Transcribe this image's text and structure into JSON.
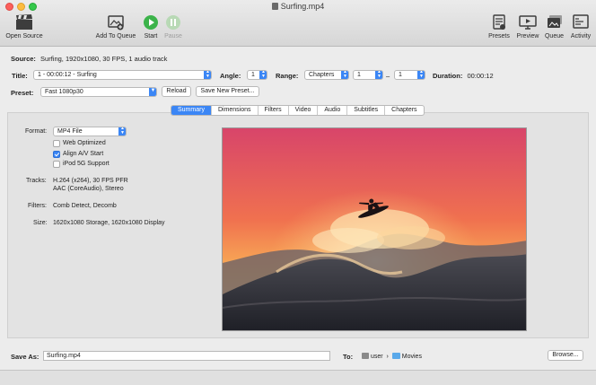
{
  "window": {
    "title": "Surfing.mp4"
  },
  "toolbar": {
    "open_source": "Open Source",
    "add_to_queue": "Add To Queue",
    "start": "Start",
    "pause": "Pause",
    "presets": "Presets",
    "preview": "Preview",
    "queue": "Queue",
    "activity": "Activity"
  },
  "source": {
    "label": "Source:",
    "value": "Surfing, 1920x1080, 30 FPS, 1 audio track"
  },
  "title_row": {
    "title_label": "Title:",
    "title_value": "1 - 00:00:12 - Surfing",
    "angle_label": "Angle:",
    "angle_value": "1",
    "range_label": "Range:",
    "range_type": "Chapters",
    "range_start": "1",
    "range_sep": "–",
    "range_end": "1",
    "duration_label": "Duration:",
    "duration_value": "00:00:12"
  },
  "preset_row": {
    "label": "Preset:",
    "value": "Fast 1080p30",
    "reload": "Reload",
    "save_new": "Save New Preset..."
  },
  "tabs": [
    "Summary",
    "Dimensions",
    "Filters",
    "Video",
    "Audio",
    "Subtitles",
    "Chapters"
  ],
  "summary": {
    "format_label": "Format:",
    "format_value": "MP4 File",
    "web_optimized": "Web Optimized",
    "web_optimized_checked": false,
    "align_av": "Align A/V Start",
    "align_av_checked": true,
    "ipod": "iPod 5G Support",
    "ipod_checked": false,
    "tracks_label": "Tracks:",
    "tracks_line1": "H.264 (x264), 30 FPS PFR",
    "tracks_line2": "AAC (CoreAudio), Stereo",
    "filters_label": "Filters:",
    "filters_value": "Comb Detect, Decomb",
    "size_label": "Size:",
    "size_value": "1620x1080 Storage, 1620x1080 Display"
  },
  "save": {
    "label": "Save As:",
    "value": "Surfing.mp4",
    "to_label": "To:",
    "user": "user",
    "sep": "›",
    "folder": "Movies",
    "browse": "Browse..."
  },
  "colors": {
    "accent": "#3b86f5",
    "start_green": "#3cb34a"
  }
}
